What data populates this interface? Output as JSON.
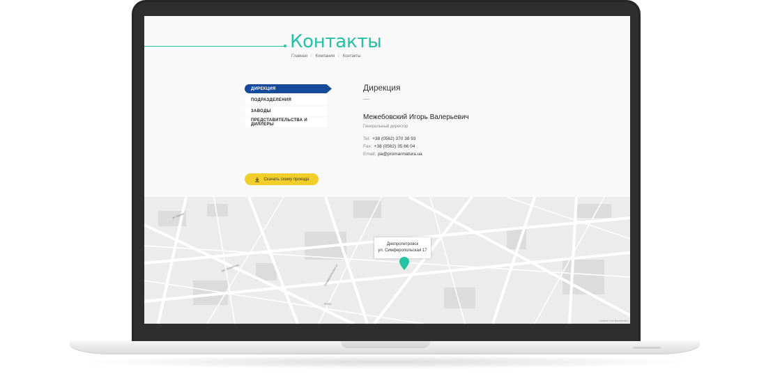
{
  "page": {
    "title": "Контакты",
    "breadcrumb": [
      "Главная",
      "Компания",
      "Контакты"
    ]
  },
  "sidebar": {
    "items": [
      {
        "label": "Дирекция",
        "active": true
      },
      {
        "label": "Подразделения",
        "active": false
      },
      {
        "label": "Заводы",
        "active": false
      },
      {
        "label": "Представительства и диллеры",
        "active": false
      }
    ],
    "download_label": "Скачать схему проезда",
    "download_icon": "download-icon"
  },
  "content": {
    "section_title": "Дирекция",
    "person_name": "Межебовский Игорь Валерьевич",
    "person_role": "Генеральный директор",
    "contacts": [
      {
        "label": "Tel:",
        "value": "+38 (0562) 370 38 93"
      },
      {
        "label": "Fax:",
        "value": "+38 (0562) 35 66 04"
      },
      {
        "label": "Email:",
        "value": "pa@promarmatura.ua"
      }
    ]
  },
  "map": {
    "label_city": "Днепропетровск",
    "label_address": "ул. Симферопольская 17",
    "copyright": "Creative Club Bandulenkov",
    "marker_color": "#25c1a5",
    "streets": [
      "вул. Погребняка",
      "Симферопольская ул.",
      "ул. Кирова",
      "PRICE"
    ]
  },
  "colors": {
    "accent": "#25c1a5",
    "active_menu": "#164a9a",
    "button": "#f2ce2b"
  }
}
